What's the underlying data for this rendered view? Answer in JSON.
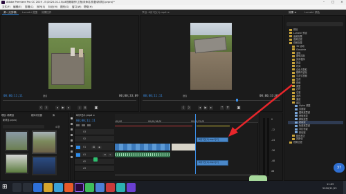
{
  "window": {
    "title": "Adobe Premiere Pro CC 2019 - E:\\2020-01-15\\AE视频制作\\工程\\未命名\\恢复\\新项目.prproj *",
    "controls": [
      "–",
      "□",
      "×"
    ]
  },
  "menu": [
    "文件(F)",
    "编辑(E)",
    "剪辑(C)",
    "序列(S)",
    "标记(M)",
    "图形(G)",
    "窗口(W)",
    "帮助(H)"
  ],
  "source_monitor": {
    "tabs": [
      "源: (无剪辑)",
      "Lumetri 范围",
      "效果控件",
      "音频剪辑混合器"
    ],
    "timecode": "00;00;11;11",
    "fit": "适合",
    "duration": "00;00;33;09"
  },
  "program_monitor": {
    "tab": "节目: 6月7日(1).mp4 ≡",
    "timecode": "00;00;11;11",
    "fit": "适合",
    "duration": "00;00;33;09"
  },
  "effects_panel": {
    "tabs": [
      "效果 ≡",
      "Lumetri 颜色"
    ],
    "search_placeholder": "",
    "items": [
      {
        "label": "预设",
        "level": 0
      },
      {
        "label": "Lumetri 预设",
        "level": 0
      },
      {
        "label": "音频效果",
        "level": 0
      },
      {
        "label": "音频过渡",
        "level": 0
      },
      {
        "label": "视频效果",
        "level": 0
      },
      {
        "label": "3D 运动",
        "level": 1
      },
      {
        "label": "Obsolete",
        "level": 1
      },
      {
        "label": "变换",
        "level": 1
      },
      {
        "label": "图像控制",
        "level": 1
      },
      {
        "label": "实用程序",
        "level": 1
      },
      {
        "label": "扭曲",
        "level": 1
      },
      {
        "label": "时间",
        "level": 1
      },
      {
        "label": "杂色与颗粒",
        "level": 1
      },
      {
        "label": "模糊与锐化",
        "level": 1
      },
      {
        "label": "沉浸式视频",
        "level": 1
      },
      {
        "label": "生成",
        "level": 1
      },
      {
        "label": "视频",
        "level": 1
      },
      {
        "label": "调整",
        "level": 1
      },
      {
        "label": "过时",
        "level": 1
      },
      {
        "label": "过渡",
        "level": 1
      },
      {
        "label": "透视",
        "level": 1
      },
      {
        "label": "通道",
        "level": 1
      },
      {
        "label": "键控",
        "level": 1
      },
      {
        "label": "Alpha 调整",
        "level": 2
      },
      {
        "label": "亮度键",
        "level": 2
      },
      {
        "label": "图像遮罩键",
        "level": 2
      },
      {
        "label": "差值遮罩",
        "level": 2
      },
      {
        "label": "移除遮罩",
        "level": 2
      },
      {
        "label": "超级键",
        "level": 2,
        "selected": true
      },
      {
        "label": "轨道遮罩键",
        "level": 2
      },
      {
        "label": "非红色键",
        "level": 2
      },
      {
        "label": "颜色键",
        "level": 2
      },
      {
        "label": "颜色校正",
        "level": 1
      },
      {
        "label": "风格化",
        "level": 1
      },
      {
        "label": "视频过渡",
        "level": 0
      }
    ]
  },
  "project_panel": {
    "tabs": [
      "项目: 新项目",
      "媒体浏览器",
      "库"
    ],
    "name": "新项目.prproj",
    "count": "4 项"
  },
  "timeline": {
    "tab": "6月7日(1).mp4 ≡",
    "timecode": "00;00;11;11",
    "ruler": [
      ":00;00",
      "00;00;16;00",
      "00;00;32;00"
    ],
    "tracks": [
      "V3",
      "V2",
      "V1",
      "A1",
      "A2",
      "A3"
    ],
    "clip_labels": [
      "6月7日(1).mp4 [V]",
      "6月7日(1).mp4 [V]"
    ],
    "audio_meter": [
      "0",
      "-12",
      "-24",
      "-36",
      "-48",
      "dB"
    ]
  },
  "taskbar": {
    "time": "11:09",
    "date": "2020/11/12",
    "badge": "37"
  },
  "colors": {
    "accent": "#2d8ceb",
    "arrow": "#e8262b",
    "clip_video": "#4a88c9",
    "clip_audio": "#3b7a54"
  }
}
